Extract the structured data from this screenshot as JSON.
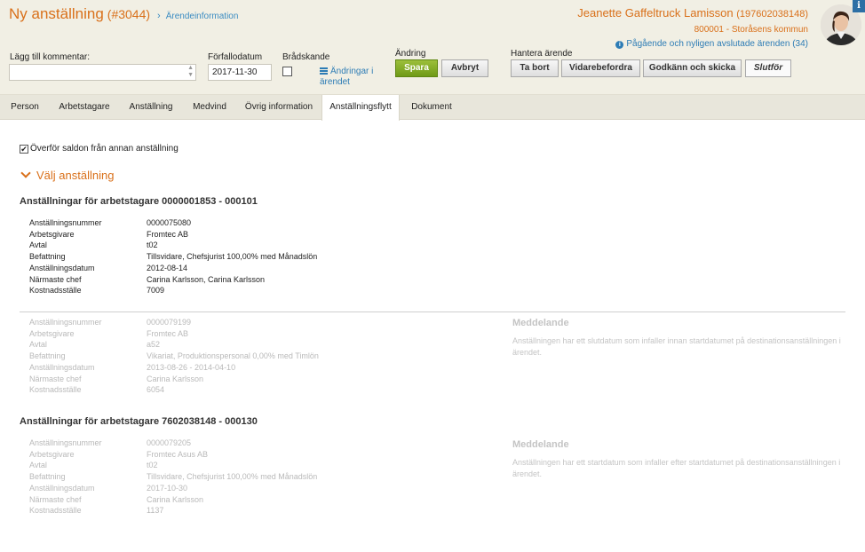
{
  "header": {
    "title": "Ny anställning",
    "case_id": "(#3044)",
    "breadcrumb_sep": "›",
    "breadcrumb": "Ärendeinformation",
    "user_name": "Jeanette Gaffeltruck Lamisson",
    "user_pnr": "(197602038148)",
    "user_org": "800001 - Storåsens kommun",
    "cases_link": "Pågående och nyligen avslutade ärenden (34)",
    "info_glyph": "i",
    "cases_icon_glyph": "i"
  },
  "toolbar": {
    "comment_label": "Lägg till kommentar:",
    "comment_value": "",
    "due_label": "Förfallodatum",
    "due_value": "2017-11-30",
    "urgent_label": "Brådskande",
    "urgent_checked": false,
    "changes_link": "Ändringar i ärendet",
    "change_label": "Ändring",
    "save": "Spara",
    "cancel": "Avbryt",
    "manage_label": "Hantera ärende",
    "delete": "Ta bort",
    "forward": "Vidarebefordra",
    "approve": "Godkänn och skicka",
    "finish": "Slutför"
  },
  "tabs": [
    "Person",
    "Arbetstagare",
    "Anställning",
    "Medvind",
    "Övrig information",
    "Anställningsflytt",
    "Dokument"
  ],
  "active_tab": "Anställningsflytt",
  "content": {
    "transfer_label": "Överför saldon från annan anställning",
    "transfer_checked": true,
    "check_glyph": "✔",
    "select_employment": "Välj anställning",
    "group1": {
      "heading": "Anställningar för arbetstagare 0000001853 - 000101",
      "fields": [
        "Anställningsnummer",
        "Arbetsgivare",
        "Avtal",
        "Befattning",
        "Anställningsdatum",
        "Närmaste chef",
        "Kostnadsställe"
      ],
      "emp1": [
        "0000075080",
        "Fromtec AB",
        "t02",
        "Tillsvidare, Chefsjurist 100,00% med Månadslön",
        "2012-08-14",
        "Carina Karlsson, Carina Karlsson",
        "7009"
      ],
      "emp2": [
        "0000079199",
        "Fromtec AB",
        "a52",
        "Vikariat, Produktionspersonal 0,00% med Timlön",
        "2013-08-26 - 2014-04-10",
        "Carina Karlsson",
        "6054"
      ],
      "emp2_msg_title": "Meddelande",
      "emp2_msg": "Anställningen har ett slutdatum som infaller innan startdatumet på destinationsanställningen i ärendet."
    },
    "group2": {
      "heading": "Anställningar för arbetstagare 7602038148 - 000130",
      "fields": [
        "Anställningsnummer",
        "Arbetsgivare",
        "Avtal",
        "Befattning",
        "Anställningsdatum",
        "Närmaste chef",
        "Kostnadsställe"
      ],
      "emp1": [
        "0000079205",
        "Fromtec Asus AB",
        "t02",
        "Tillsvidare, Chefsjurist 100,00% med Månadslön",
        "2017-10-30",
        "Carina Karlsson",
        "1137"
      ],
      "emp1_msg_title": "Meddelande",
      "emp1_msg": "Anställningen har ett startdatum som infaller efter startdatumet på destinationsanställningen i ärendet."
    }
  }
}
